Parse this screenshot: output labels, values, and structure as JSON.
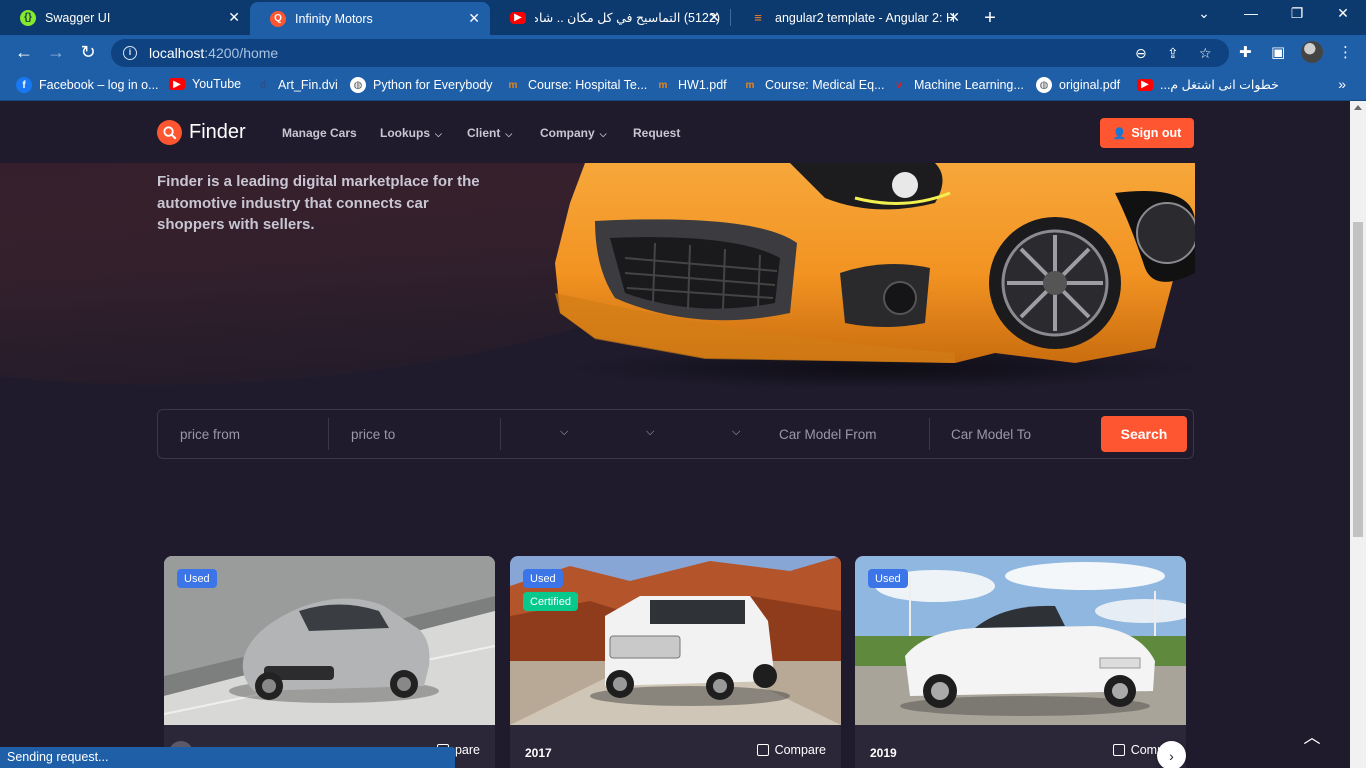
{
  "browser": {
    "tabs": [
      {
        "title": "Swagger UI",
        "favicon_color": "#85ea2d",
        "active": false
      },
      {
        "title": "Infinity Motors",
        "favicon_color": "#fd5631",
        "active": true
      },
      {
        "title": "(5122) التماسيح في كل مكان .. شاه",
        "favicon_color": "#ff0000",
        "active": false
      },
      {
        "title": "angular2 template - Angular 2: H",
        "favicon_color": "#f48024",
        "active": false
      }
    ],
    "url_host": "localhost",
    "url_path": ":4200/home",
    "bookmarks": [
      {
        "label": "Facebook – log in o...",
        "color": "#1877f2",
        "glyph": "f"
      },
      {
        "label": "YouTube",
        "color": "#ff0000",
        "glyph": "▶"
      },
      {
        "label": "Art_Fin.dvi",
        "color": "#2b4f86",
        "glyph": "d"
      },
      {
        "label": "Python for Everybody",
        "color": "#555555",
        "glyph": "◍"
      },
      {
        "label": "Course: Hospital Te...",
        "color": "#e8851a",
        "glyph": "m"
      },
      {
        "label": "HW1.pdf",
        "color": "#e8851a",
        "glyph": "m"
      },
      {
        "label": "Course: Medical Eq...",
        "color": "#e8851a",
        "glyph": "m"
      },
      {
        "label": "Machine Learning...",
        "color": "#d2232a",
        "glyph": "ν"
      },
      {
        "label": "original.pdf",
        "color": "#555555",
        "glyph": "◍"
      },
      {
        "label": "خطوات انى اشتغل م...",
        "color": "#ff0000",
        "glyph": "▶"
      }
    ],
    "status_text": "Sending request..."
  },
  "site": {
    "logo_text": "Finder",
    "nav": [
      {
        "label": "Manage Cars",
        "dropdown": false
      },
      {
        "label": "Lookups",
        "dropdown": true
      },
      {
        "label": "Client",
        "dropdown": true
      },
      {
        "label": "Company",
        "dropdown": true
      },
      {
        "label": "Request",
        "dropdown": false
      }
    ],
    "signout_label": "Sign out",
    "hero_text": "Finder is a leading digital marketplace for the automotive industry that connects car shoppers with sellers.",
    "colors": {
      "accent": "#fd5631",
      "background": "#1f1b2d",
      "used_badge": "#3c75e8",
      "certified_badge": "#07c98b"
    }
  },
  "search": {
    "price_from_placeholder": "price from",
    "price_to_placeholder": "price to",
    "select_1_value": "",
    "select_2_value": "",
    "select_3_value": "",
    "model_from_placeholder": "Car Model From",
    "model_to_placeholder": "Car Model To",
    "button_label": "Search"
  },
  "cards": [
    {
      "badges": [
        "Used"
      ],
      "year": "",
      "compare_label": "pare"
    },
    {
      "badges": [
        "Used",
        "Certified"
      ],
      "year": "2017",
      "compare_label": "Compare"
    },
    {
      "badges": [
        "Used"
      ],
      "year": "2019",
      "compare_label": "Compa"
    }
  ]
}
